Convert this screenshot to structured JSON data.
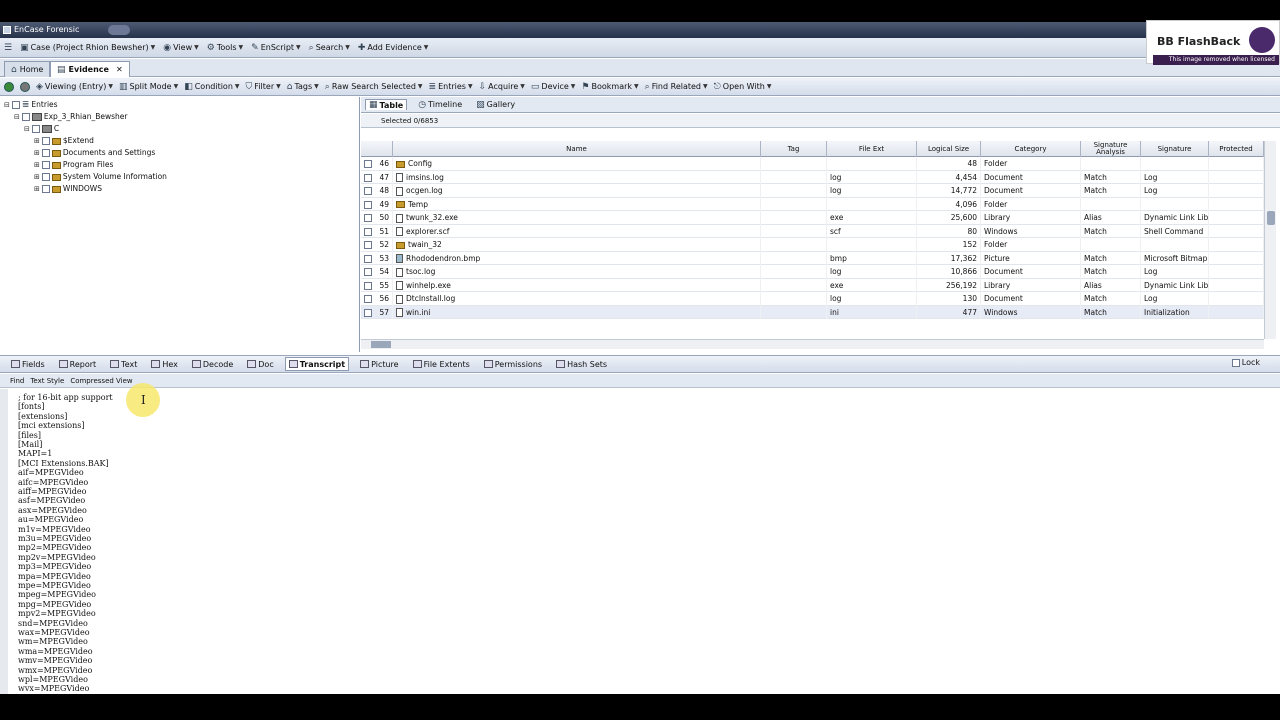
{
  "window": {
    "title": "EnCase Forensic",
    "accent": "#26324a"
  },
  "menubar": [
    {
      "label": "Case (Project Rhion Bewsher)",
      "icon": "case-icon"
    },
    {
      "label": "View",
      "icon": "view-icon"
    },
    {
      "label": "Tools",
      "icon": "tools-icon"
    },
    {
      "label": "EnScript",
      "icon": "script-icon"
    },
    {
      "label": "Search",
      "icon": "search-icon"
    },
    {
      "label": "Add Evidence",
      "icon": "add-icon"
    }
  ],
  "tabs": [
    {
      "label": "Home"
    },
    {
      "label": "Evidence"
    }
  ],
  "toolbar": {
    "viewing": "Viewing (Entry)",
    "split_mode": "Split Mode",
    "condition": "Condition",
    "filter": "Filter",
    "tags": "Tags",
    "raw_search": "Raw Search Selected",
    "entries": "Entries",
    "acquire": "Acquire",
    "device": "Device",
    "bookmark": "Bookmark",
    "find_related": "Find Related",
    "open_with": "Open With"
  },
  "tree": {
    "root": "Entries",
    "evidence": "Exp_3_Rhian_Bewsher",
    "drive": "C",
    "folders": [
      "$Extend",
      "Documents and Settings",
      "Program Files",
      "System Volume Information",
      "WINDOWS"
    ]
  },
  "view_tabs": [
    "Table",
    "Timeline",
    "Gallery"
  ],
  "selected_label": "Selected 0/6853",
  "table": {
    "headers": [
      "Name",
      "Tag",
      "File Ext",
      "Logical Size",
      "Category",
      "Signature Analysis",
      "Signature",
      "Protected"
    ],
    "rows": [
      {
        "num": "46",
        "name": "Config",
        "icon": "folder",
        "ext": "",
        "size": "48",
        "category": "Folder",
        "sig_analysis": "",
        "signature": ""
      },
      {
        "num": "47",
        "name": "imsins.log",
        "icon": "file",
        "ext": "log",
        "size": "4,454",
        "category": "Document",
        "sig_analysis": "Match",
        "signature": "Log"
      },
      {
        "num": "48",
        "name": "ocgen.log",
        "icon": "file",
        "ext": "log",
        "size": "14,772",
        "category": "Document",
        "sig_analysis": "Match",
        "signature": "Log"
      },
      {
        "num": "49",
        "name": "Temp",
        "icon": "folder",
        "ext": "",
        "size": "4,096",
        "category": "Folder",
        "sig_analysis": "",
        "signature": ""
      },
      {
        "num": "50",
        "name": "twunk_32.exe",
        "icon": "file",
        "ext": "exe",
        "size": "25,600",
        "category": "Library",
        "sig_analysis": "Alias",
        "signature": "Dynamic Link Lib..."
      },
      {
        "num": "51",
        "name": "explorer.scf",
        "icon": "file",
        "ext": "scf",
        "size": "80",
        "category": "Windows",
        "sig_analysis": "Match",
        "signature": "Shell Command"
      },
      {
        "num": "52",
        "name": "twain_32",
        "icon": "folder",
        "ext": "",
        "size": "152",
        "category": "Folder",
        "sig_analysis": "",
        "signature": ""
      },
      {
        "num": "53",
        "name": "Rhododendron.bmp",
        "icon": "picture",
        "ext": "bmp",
        "size": "17,362",
        "category": "Picture",
        "sig_analysis": "Match",
        "signature": "Microsoft Bitmap..."
      },
      {
        "num": "54",
        "name": "tsoc.log",
        "icon": "file",
        "ext": "log",
        "size": "10,866",
        "category": "Document",
        "sig_analysis": "Match",
        "signature": "Log"
      },
      {
        "num": "55",
        "name": "winhelp.exe",
        "icon": "file",
        "ext": "exe",
        "size": "256,192",
        "category": "Library",
        "sig_analysis": "Alias",
        "signature": "Dynamic Link Lib..."
      },
      {
        "num": "56",
        "name": "DtcInstall.log",
        "icon": "file",
        "ext": "log",
        "size": "130",
        "category": "Document",
        "sig_analysis": "Match",
        "signature": "Log"
      },
      {
        "num": "57",
        "name": "win.ini",
        "icon": "file",
        "ext": "ini",
        "size": "477",
        "category": "Windows",
        "sig_analysis": "Match",
        "signature": "Initialization"
      }
    ]
  },
  "bottom_tabs": [
    "Fields",
    "Report",
    "Text",
    "Hex",
    "Decode",
    "Doc",
    "Transcript",
    "Picture",
    "File Extents",
    "Permissions",
    "Hash Sets"
  ],
  "lock_label": "Lock",
  "subbar": [
    "Find",
    "Text Style",
    "Compressed View"
  ],
  "text_lines": [
    "; for 16-bit app support",
    "[fonts]",
    "[extensions]",
    "[mci extensions]",
    "[files]",
    "[Mail]",
    "MAPI=1",
    "[MCI Extensions.BAK]",
    "aif=MPEGVideo",
    "aifc=MPEGVideo",
    "aiff=MPEGVideo",
    "asf=MPEGVideo",
    "asx=MPEGVideo",
    "au=MPEGVideo",
    "m1v=MPEGVideo",
    "m3u=MPEGVideo",
    "mp2=MPEGVideo",
    "mp2v=MPEGVideo",
    "mp3=MPEGVideo",
    "mpa=MPEGVideo",
    "mpe=MPEGVideo",
    "mpeg=MPEGVideo",
    "mpg=MPEGVideo",
    "mpv2=MPEGVideo",
    "snd=MPEGVideo",
    "wax=MPEGVideo",
    "wm=MPEGVideo",
    "wma=MPEGVideo",
    "wmv=MPEGVideo",
    "wmx=MPEGVideo",
    "wpl=MPEGVideo",
    "wvx=MPEGVideo"
  ],
  "watermark": {
    "title": "BB FlashBack",
    "subtitle": "This image removed when licensed"
  }
}
